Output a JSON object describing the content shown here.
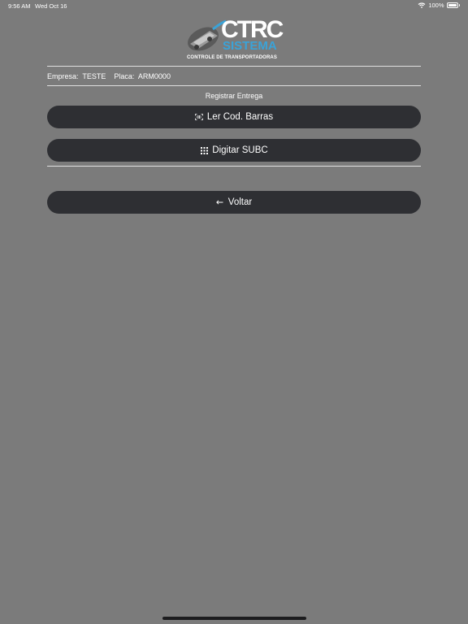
{
  "status_bar": {
    "time": "9:56 AM",
    "date": "Wed Oct 16",
    "battery_percent": "100%"
  },
  "logo": {
    "brand": "CTRC",
    "sub_brand": "SISTEMA",
    "tagline": "CONTROLE DE TRANSPORTADORAS",
    "brand_color": "#3aa3d8"
  },
  "info": {
    "empresa_label": "Empresa:",
    "empresa_value": "TESTE",
    "placa_label": "Placa:",
    "placa_value": "ARM0000"
  },
  "section": {
    "title": "Registrar Entrega"
  },
  "buttons": {
    "scan": {
      "label": "Ler Cod. Barras",
      "icon": "barcode-scan-icon"
    },
    "type": {
      "label": "Digitar SUBC",
      "icon": "keypad-grid-icon"
    },
    "back": {
      "label": "Voltar",
      "icon": "arrow-left-icon"
    }
  },
  "colors": {
    "background": "#7b7b7b",
    "button": "#2e2f33"
  }
}
